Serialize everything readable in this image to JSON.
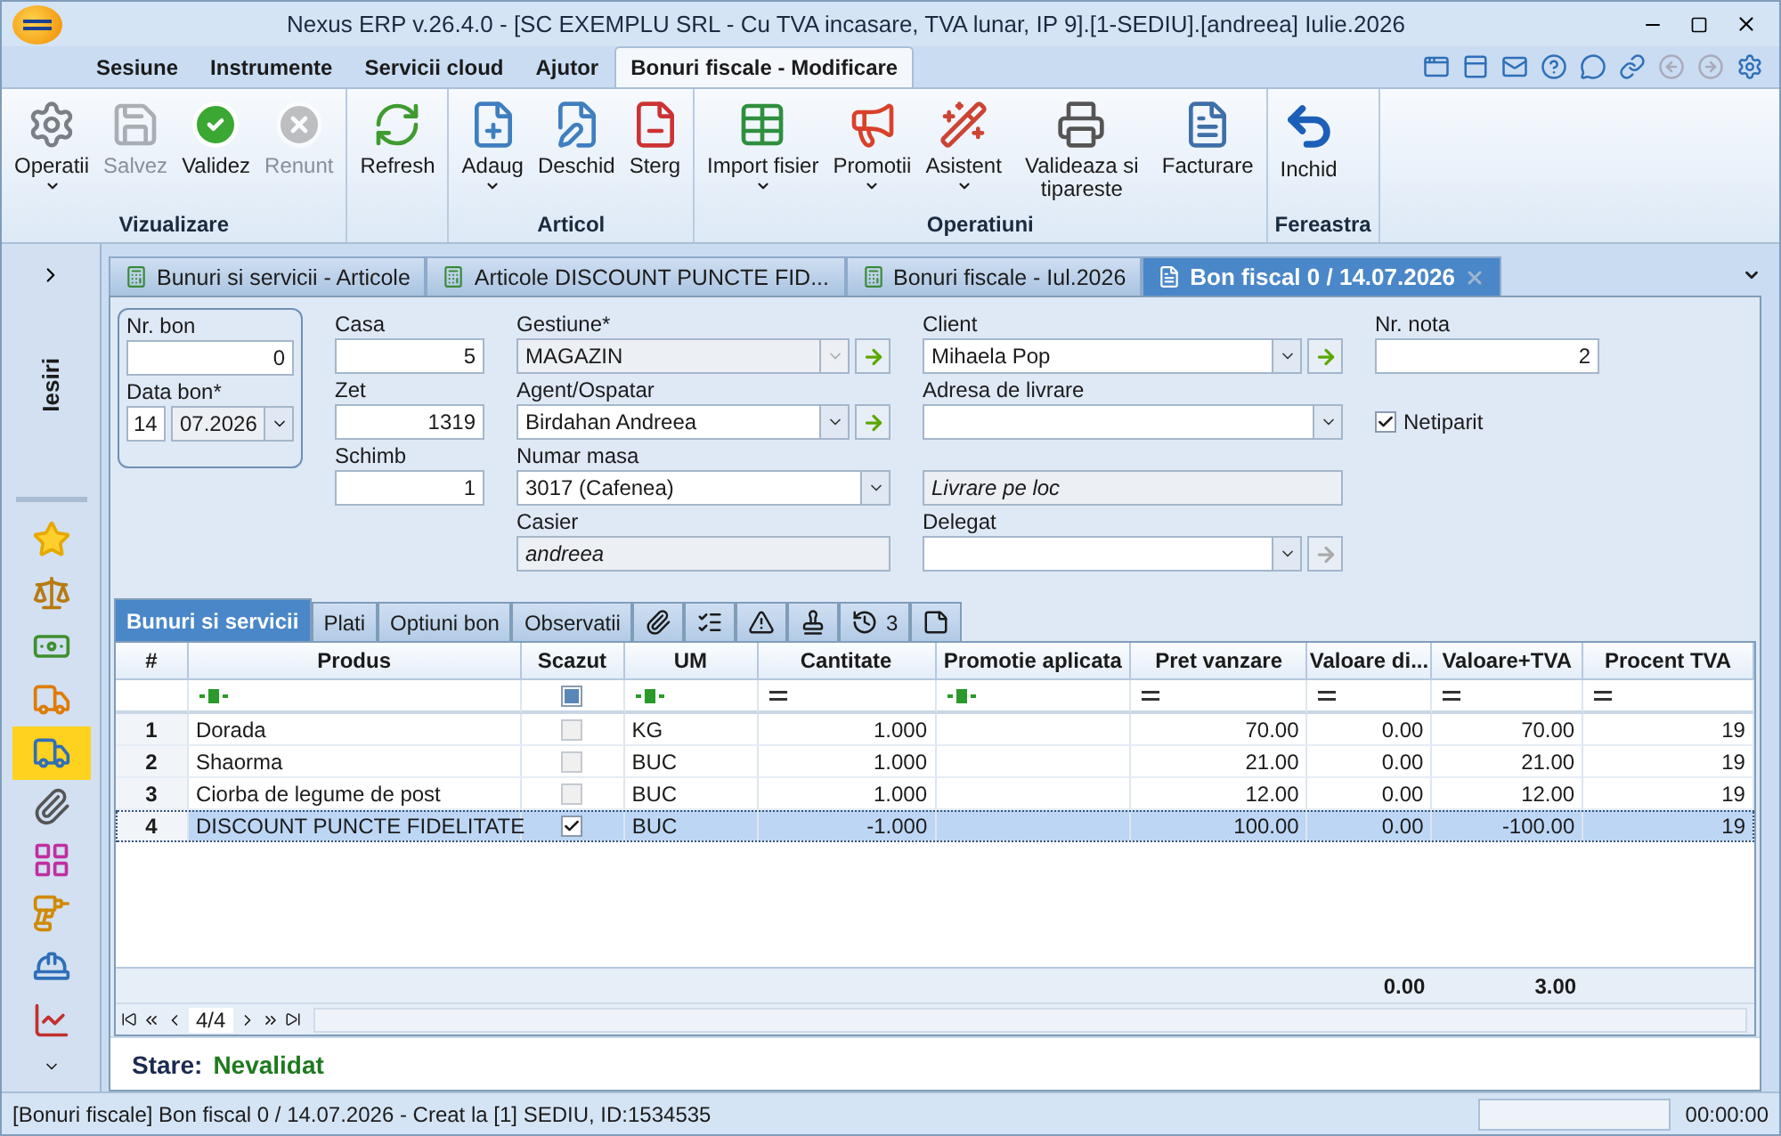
{
  "window": {
    "title": "Nexus ERP v.26.4.0 - [SC EXEMPLU SRL - Cu TVA incasare, TVA lunar, IP 9].[1-SEDIU].[andreea] Iulie.2026"
  },
  "menu_tabs": [
    {
      "label": "Sesiune",
      "selected": false
    },
    {
      "label": "Instrumente",
      "selected": false
    },
    {
      "label": "Servicii cloud",
      "selected": false
    },
    {
      "label": "Ajutor",
      "selected": false
    },
    {
      "label": "Bonuri fiscale -  Modificare",
      "selected": true
    }
  ],
  "ribbon": [
    {
      "title": "Vizualizare",
      "buttons": [
        {
          "label": "Operatii",
          "menu": true,
          "disabled": false
        },
        {
          "label": "Salvez",
          "menu": false,
          "disabled": true
        },
        {
          "label": "Validez",
          "menu": false,
          "disabled": false
        },
        {
          "label": "Renunt",
          "menu": false,
          "disabled": true
        }
      ]
    },
    {
      "buttons": [
        {
          "label": "Refresh",
          "menu": false,
          "disabled": false
        }
      ]
    },
    {
      "title": "Articol",
      "buttons": [
        {
          "label": "Adaug",
          "menu": true,
          "disabled": false
        },
        {
          "label": "Deschid",
          "menu": false,
          "disabled": false
        },
        {
          "label": "Sterg",
          "menu": false,
          "disabled": false
        }
      ]
    },
    {
      "title": "Operatiuni",
      "buttons": [
        {
          "label": "Import fisier",
          "menu": true,
          "disabled": false
        },
        {
          "label": "Promotii",
          "menu": true,
          "disabled": false
        },
        {
          "label": "Asistent",
          "menu": true,
          "disabled": false
        },
        {
          "label": "Valideaza si tipareste",
          "menu": false,
          "disabled": false
        },
        {
          "label": "Facturare",
          "menu": false,
          "disabled": false
        }
      ]
    },
    {
      "title": "Fereastra",
      "buttons": [
        {
          "label": "Inchid",
          "menu": false,
          "disabled": false
        }
      ]
    }
  ],
  "sidebar": {
    "title": "Iesiri",
    "items": [
      {
        "selected": false
      },
      {
        "selected": false
      },
      {
        "selected": false
      },
      {
        "selected": false
      },
      {
        "selected": true
      },
      {
        "selected": false
      },
      {
        "selected": false
      },
      {
        "selected": false
      },
      {
        "selected": false
      },
      {
        "selected": false
      }
    ]
  },
  "doc_tabs": [
    {
      "label": "Bunuri si servicii - Articole",
      "selected": false
    },
    {
      "label": "Articole DISCOUNT PUNCTE FID...",
      "selected": false
    },
    {
      "label": "Bonuri fiscale - Iul.2026",
      "selected": false
    },
    {
      "label": "Bon fiscal 0 / 14.07.2026",
      "selected": true
    }
  ],
  "form": {
    "columns": [
      [
        {
          "label": "Nr. bon",
          "kind": "number",
          "value": "0"
        },
        {
          "label": "Data bon*",
          "kind": "date",
          "day": "14",
          "value": "07.2026"
        }
      ],
      [
        {
          "label": "Casa",
          "kind": "number",
          "value": "5"
        },
        {
          "label": "Zet",
          "kind": "number",
          "value": "1319"
        },
        {
          "label": "Schimb",
          "kind": "number",
          "value": "1"
        }
      ],
      [
        {
          "label": "Gestiune*",
          "kind": "combo",
          "value": "MAGAZIN",
          "disabled": true,
          "go_button": {
            "disabled": false
          }
        },
        {
          "label": "Agent/Ospatar",
          "kind": "combo",
          "value": "Birdahan Andreea",
          "disabled": false,
          "go_button": {
            "disabled": false
          }
        },
        {
          "label": "Numar masa",
          "kind": "combo",
          "value": "3017 (Cafenea)",
          "disabled": false
        },
        {
          "label": "Casier",
          "kind": "static",
          "value": "andreea"
        }
      ],
      [
        {
          "label": "Client",
          "kind": "combo",
          "value": "Mihaela Pop",
          "disabled": false,
          "go_button": {
            "disabled": false
          }
        },
        {
          "label": "Adresa de livrare",
          "kind": "combo",
          "disabled": false
        },
        {
          "kind": "static",
          "value": "Livrare pe loc"
        },
        {
          "label": "Delegat",
          "kind": "combo",
          "disabled": false,
          "go_button": {
            "disabled": true
          }
        }
      ],
      [
        {
          "label": "Nr. nota",
          "kind": "number",
          "value": "2"
        },
        {
          "kind": "checkbox",
          "value": "Netiparit",
          "checked": true
        }
      ]
    ]
  },
  "sub_tabs": [
    {
      "kind": "text",
      "label": "Bunuri si servicii",
      "selected": true
    },
    {
      "kind": "text",
      "label": "Plati",
      "selected": false
    },
    {
      "kind": "text",
      "label": "Optiuni bon",
      "selected": false
    },
    {
      "kind": "text",
      "label": "Observatii",
      "selected": false
    },
    {
      "kind": "icon",
      "selected": false
    },
    {
      "kind": "icon",
      "selected": false
    },
    {
      "kind": "icon",
      "selected": false
    },
    {
      "kind": "icon",
      "selected": false
    },
    {
      "kind": "icon",
      "count": "3",
      "selected": false
    },
    {
      "kind": "icon",
      "selected": false
    }
  ],
  "table": {
    "columns": [
      {
        "label": "#",
        "kind": "index"
      },
      {
        "label": "Produs",
        "kind": "text"
      },
      {
        "label": "Scazut",
        "kind": "check",
        "filter_indeterminate": true
      },
      {
        "label": "UM",
        "kind": "text"
      },
      {
        "label": "Cantitate",
        "kind": "number"
      },
      {
        "label": "Promotie aplicata",
        "kind": "text"
      },
      {
        "label": "Pret vanzare",
        "kind": "number"
      },
      {
        "label": "Valoare di...",
        "kind": "number",
        "total": "0.00"
      },
      {
        "label": "Valoare+TVA",
        "kind": "number",
        "total": "3.00"
      },
      {
        "label": "Procent TVA",
        "kind": "number"
      }
    ],
    "rows": [
      {
        "nr": "1",
        "produs": "Dorada",
        "scazut": false,
        "um": "KG",
        "cantitate": "1.000",
        "pret": "70.00",
        "discount": "0.00",
        "valoare": "70.00",
        "tva": "19",
        "selected": false
      },
      {
        "nr": "2",
        "produs": "Shaorma",
        "scazut": false,
        "um": "BUC",
        "cantitate": "1.000",
        "pret": "21.00",
        "discount": "0.00",
        "valoare": "21.00",
        "tva": "19",
        "selected": false
      },
      {
        "nr": "3",
        "produs": "Ciorba de legume de post",
        "scazut": false,
        "um": "BUC",
        "cantitate": "1.000",
        "pret": "12.00",
        "discount": "0.00",
        "valoare": "12.00",
        "tva": "19",
        "selected": false
      },
      {
        "nr": "4",
        "produs": "DISCOUNT PUNCTE FIDELITATE",
        "scazut": true,
        "um": "BUC",
        "cantitate": "-1.000",
        "pret": "100.00",
        "discount": "0.00",
        "valoare": "-100.00",
        "tva": "19",
        "selected": true
      }
    ],
    "navigator": "4/4"
  },
  "state": {
    "label": "Stare:",
    "value": "Nevalidat"
  },
  "status_bar": {
    "text": "[Bonuri fiscale] Bon fiscal 0 / 14.07.2026 - Creat la [1] SEDIU, ID:1534535",
    "time": "00:00:00"
  }
}
